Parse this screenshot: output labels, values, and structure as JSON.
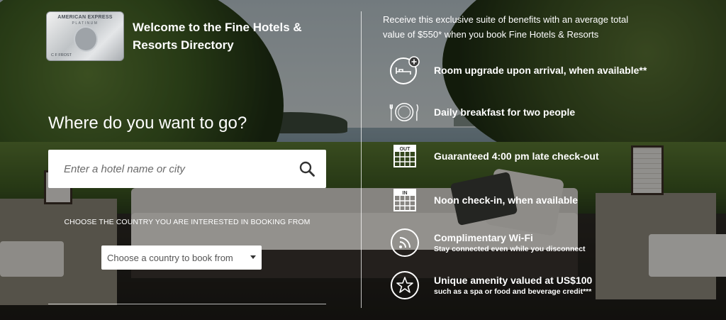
{
  "card": {
    "brand": "AMERICAN EXPRESS",
    "tier": "PLATINUM",
    "cardholder": "C F FROST"
  },
  "welcome": "Welcome to the Fine Hotels & Resorts Directory",
  "headline": "Where do you want to go?",
  "search": {
    "placeholder": "Enter a hotel name or city",
    "icon": "search-icon"
  },
  "country": {
    "label": "CHOOSE THE COUNTRY YOU ARE INTERESTED IN BOOKING FROM",
    "selected": "Choose a country to book from",
    "icon": "caret-down-icon"
  },
  "benefits_intro": "Receive this exclusive suite of benefits with an average total value of $550* when you book Fine Hotels & Resorts",
  "benefits": [
    {
      "icon": "room-upgrade-icon",
      "title": "Room upgrade upon arrival, when available**",
      "subtitle": ""
    },
    {
      "icon": "breakfast-icon",
      "title": "Daily breakfast for two people",
      "subtitle": ""
    },
    {
      "icon": "late-checkout-icon",
      "title": "Guaranteed 4:00 pm late check-out",
      "subtitle": "",
      "badge": "OUT"
    },
    {
      "icon": "noon-checkin-icon",
      "title": "Noon check-in, when available",
      "subtitle": "",
      "badge": "IN"
    },
    {
      "icon": "wifi-icon",
      "title": "Complimentary Wi-Fi",
      "subtitle": "Stay connected even while you disconnect"
    },
    {
      "icon": "amenity-star-icon",
      "title": "Unique amenity valued at US$100",
      "subtitle": "such as a spa or food and beverage credit***"
    }
  ],
  "colors": {
    "text": "#ffffff",
    "input_bg": "#ffffff",
    "placeholder": "#6a6a6a"
  }
}
